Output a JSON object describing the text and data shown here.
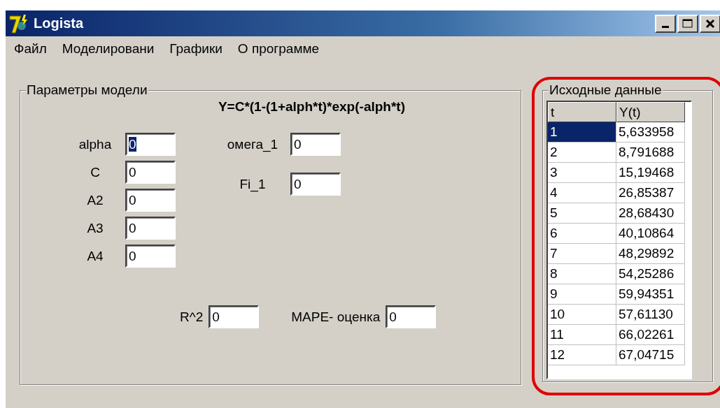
{
  "window": {
    "title": "Logista"
  },
  "menu": [
    {
      "label": "Файл"
    },
    {
      "label": "Моделировани"
    },
    {
      "label": "Графики"
    },
    {
      "label": "О программе"
    }
  ],
  "params_group": {
    "title": "Параметры модели",
    "formula": "Y=C*(1-(1+alph*t)*exp(-alph*t)",
    "fields_left": [
      {
        "label": "alpha",
        "value": "0",
        "focused": true
      },
      {
        "label": "C",
        "value": "0",
        "focused": false
      },
      {
        "label": "A2",
        "value": "0",
        "focused": false
      },
      {
        "label": "A3",
        "value": "0",
        "focused": false
      },
      {
        "label": "A4",
        "value": "0",
        "focused": false
      }
    ],
    "fields_right": [
      {
        "label": "омега_1",
        "value": "0",
        "focused": false
      },
      {
        "label": "Fi_1",
        "value": "0",
        "focused": false
      }
    ],
    "results": [
      {
        "label": "R^2",
        "value": "0"
      },
      {
        "label": "MAPE- оценка",
        "value": "0"
      }
    ]
  },
  "data_group": {
    "title": "Исходные данные",
    "highlighted": true,
    "table": {
      "columns": [
        "t",
        "Y(t)"
      ],
      "rows": [
        {
          "cells": [
            "1",
            "5,633958"
          ],
          "selected": true
        },
        {
          "cells": [
            "2",
            "8,791688"
          ],
          "selected": false
        },
        {
          "cells": [
            "3",
            "15,19468"
          ],
          "selected": false
        },
        {
          "cells": [
            "4",
            "26,85387"
          ],
          "selected": false
        },
        {
          "cells": [
            "5",
            "28,68430"
          ],
          "selected": false
        },
        {
          "cells": [
            "6",
            "40,10864"
          ],
          "selected": false
        },
        {
          "cells": [
            "7",
            "48,29892"
          ],
          "selected": false
        },
        {
          "cells": [
            "8",
            "54,25286"
          ],
          "selected": false
        },
        {
          "cells": [
            "9",
            "59,94351"
          ],
          "selected": false
        },
        {
          "cells": [
            "10",
            "57,61130"
          ],
          "selected": false
        },
        {
          "cells": [
            "11",
            "66,02261"
          ],
          "selected": false
        },
        {
          "cells": [
            "12",
            "67,04715"
          ],
          "selected": false
        }
      ]
    }
  }
}
